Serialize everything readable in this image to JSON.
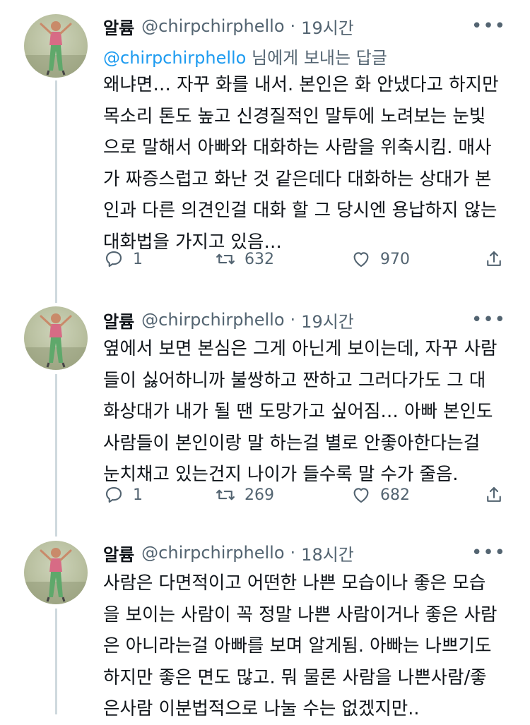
{
  "tweets": [
    {
      "name": "알륨",
      "handle": "@chirpchirphello",
      "dot": "·",
      "time": "19시간",
      "more": "•••",
      "reply_to_mention": "@chirpchirphello",
      "reply_to_suffix": " 님에게 보내는 답글",
      "lines": [
        "왜냐면… 자꾸 화를 내서. 본인은 화 안냈다고 하지만",
        "목소리 톤도 높고 신경질적인 말투에 노려보는 눈빛",
        "으로 말해서 아빠와 대화하는 사람을 위축시킴. 매사",
        "가 짜증스럽고 화난 것 같은데다 대화하는 상대가 본",
        "인과 다른 의견인걸 대화 할 그 당시엔 용납하지 않는",
        "대화법을 가지고 있음…"
      ],
      "replies": "1",
      "retweets": "632",
      "likes": "970"
    },
    {
      "name": "알륨",
      "handle": "@chirpchirphello",
      "dot": "·",
      "time": "19시간",
      "more": "•••",
      "lines": [
        "옆에서 보면 본심은 그게 아닌게 보이는데, 자꾸 사람",
        "들이 싫어하니까 불쌍하고 짠하고 그러다가도 그 대",
        "화상대가 내가 될 땐 도망가고 싶어짐… 아빠 본인도",
        "사람들이 본인이랑 말 하는걸 별로 안좋아한다는걸",
        "눈치채고 있는건지 나이가 들수록 말 수가 줄음."
      ],
      "replies": "1",
      "retweets": "269",
      "likes": "682"
    },
    {
      "name": "알륨",
      "handle": "@chirpchirphello",
      "dot": "·",
      "time": "18시간",
      "more": "•••",
      "lines": [
        "사람은 다면적이고 어떤한 나쁜 모습이나 좋은 모습",
        "을 보이는 사람이 꼭 정말 나쁜 사람이거나 좋은 사람",
        "은 아니라는걸 아빠를 보며 알게됨. 아빠는 나쁘기도",
        "하지만 좋은 면도 많고. 뭐 물론 사람을 나쁜사람/좋",
        "은사람 이분법적으로 나눌 수는 없겠지만.."
      ]
    }
  ],
  "icons": {
    "reply": "reply-icon",
    "retweet": "retweet-icon",
    "like": "like-icon",
    "share": "share-icon",
    "more": "more-icon"
  },
  "colors": {
    "mention": "#1d9bf0",
    "secondary_text": "#536471",
    "thread_line": "#cfd9de"
  }
}
